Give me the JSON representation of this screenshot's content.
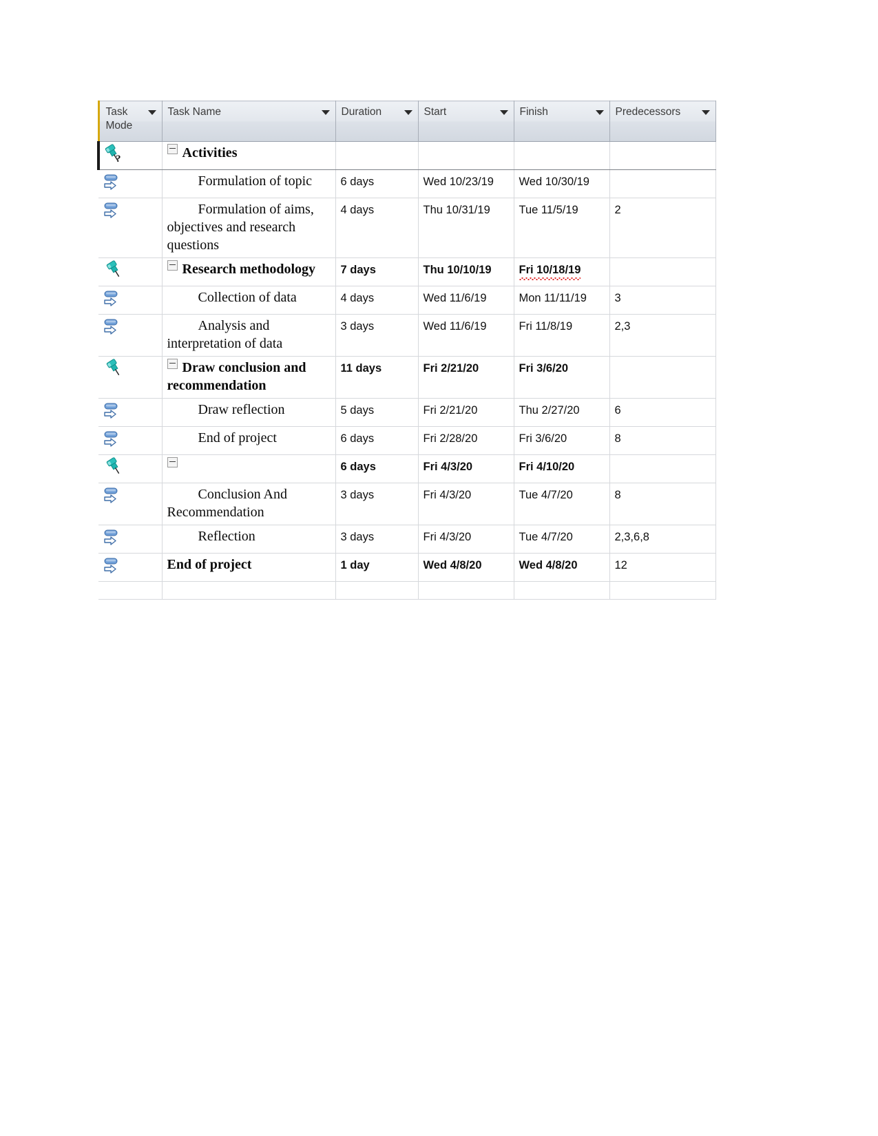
{
  "table": {
    "columns": [
      {
        "key": "task_mode",
        "label": "Task\nMode",
        "icon": "filter-dropdown-icon"
      },
      {
        "key": "task_name",
        "label": "Task Name",
        "icon": "filter-dropdown-icon"
      },
      {
        "key": "duration",
        "label": "Duration",
        "icon": "filter-dropdown-icon"
      },
      {
        "key": "start",
        "label": "Start",
        "icon": "filter-dropdown-icon"
      },
      {
        "key": "finish",
        "label": "Finish",
        "icon": "filter-dropdown-icon"
      },
      {
        "key": "predecessors",
        "label": "Predecessors",
        "icon": "filter-dropdown-icon"
      }
    ],
    "rows": [
      {
        "task_mode_icon": "manually-scheduled-pin-question-icon",
        "mode": "manual-unknown",
        "outline": "collapse-minus-icon",
        "indent": 0,
        "task_name": "Activities",
        "bold": true,
        "duration": "",
        "start": "",
        "finish": "",
        "predecessors": "",
        "selected": true
      },
      {
        "task_mode_icon": "auto-scheduled-arrow-icon",
        "mode": "auto",
        "outline": "",
        "indent": 1,
        "task_name": "Formulation of topic",
        "bold": false,
        "duration": "6 days",
        "start": "Wed 10/23/19",
        "finish": "Wed 10/30/19",
        "predecessors": "",
        "selected": false
      },
      {
        "task_mode_icon": "auto-scheduled-arrow-icon",
        "mode": "auto",
        "outline": "",
        "indent": 1,
        "task_name": "Formulation of aims, objectives and research questions",
        "bold": false,
        "duration": "4 days",
        "start": "Thu 10/31/19",
        "finish": "Tue 11/5/19",
        "predecessors": "2",
        "selected": false
      },
      {
        "task_mode_icon": "manually-scheduled-pin-icon",
        "mode": "manual",
        "outline": "collapse-minus-icon",
        "indent": 0,
        "task_name": "Research methodology",
        "bold": true,
        "duration": "7 days",
        "start": "Thu 10/10/19",
        "finish": "Fri 10/18/19",
        "finish_spellcheck": true,
        "predecessors": "",
        "selected": false
      },
      {
        "task_mode_icon": "auto-scheduled-arrow-icon",
        "mode": "auto",
        "outline": "",
        "indent": 1,
        "task_name": "Collection of data",
        "bold": false,
        "duration": "4 days",
        "start": "Wed 11/6/19",
        "finish": "Mon 11/11/19",
        "predecessors": "3",
        "selected": false
      },
      {
        "task_mode_icon": "auto-scheduled-arrow-icon",
        "mode": "auto",
        "outline": "",
        "indent": 1,
        "task_name": "Analysis and interpretation of data",
        "bold": false,
        "duration": "3 days",
        "start": "Wed 11/6/19",
        "finish": "Fri 11/8/19",
        "predecessors": "2,3",
        "selected": false
      },
      {
        "task_mode_icon": "manually-scheduled-pin-icon",
        "mode": "manual",
        "outline": "collapse-minus-icon",
        "indent": 0,
        "task_name": "Draw conclusion and recommendation",
        "bold": true,
        "duration": "11 days",
        "start": "Fri 2/21/20",
        "finish": "Fri 3/6/20",
        "predecessors": "",
        "selected": false
      },
      {
        "task_mode_icon": "auto-scheduled-arrow-icon",
        "mode": "auto",
        "outline": "",
        "indent": 1,
        "task_name": "Draw reflection",
        "bold": false,
        "duration": "5 days",
        "start": "Fri 2/21/20",
        "finish": "Thu 2/27/20",
        "predecessors": "6",
        "selected": false
      },
      {
        "task_mode_icon": "auto-scheduled-arrow-icon",
        "mode": "auto",
        "outline": "",
        "indent": 1,
        "task_name": "End of project",
        "bold": false,
        "duration": "6 days",
        "start": "Fri 2/28/20",
        "finish": "Fri 3/6/20",
        "predecessors": "8",
        "selected": false
      },
      {
        "task_mode_icon": "manually-scheduled-pin-icon",
        "mode": "manual",
        "outline": "collapse-minus-icon",
        "indent": 0,
        "task_name": "",
        "bold": true,
        "duration": "6 days",
        "start": "Fri 4/3/20",
        "finish": "Fri 4/10/20",
        "predecessors": "",
        "selected": false
      },
      {
        "task_mode_icon": "auto-scheduled-arrow-icon",
        "mode": "auto",
        "outline": "",
        "indent": 1,
        "task_name": "Conclusion And Recommendation",
        "bold": false,
        "duration": "3 days",
        "start": "Fri 4/3/20",
        "finish": "Tue 4/7/20",
        "predecessors": "8",
        "selected": false
      },
      {
        "task_mode_icon": "auto-scheduled-arrow-icon",
        "mode": "auto",
        "outline": "",
        "indent": 1,
        "task_name": "Reflection",
        "bold": false,
        "duration": "3 days",
        "start": "Fri 4/3/20",
        "finish": "Tue 4/7/20",
        "predecessors": "2,3,6,8",
        "selected": false
      },
      {
        "task_mode_icon": "auto-scheduled-arrow-icon",
        "mode": "auto",
        "outline": "",
        "indent": 0,
        "task_name": "End of project",
        "bold": true,
        "duration": "1 day",
        "start": "Wed 4/8/20",
        "finish": "Wed 4/8/20",
        "predecessors": "12",
        "selected": false
      }
    ]
  },
  "colors": {
    "header_accent": "#d6a80f",
    "header_bg": "#dee3ea",
    "grid_line": "#d6d8dc",
    "pin_teal": "#1fb5b0",
    "auto_blue": "#5b8fd4",
    "spellcheck_red": "#e02020",
    "selection_black": "#1a1a1a"
  }
}
